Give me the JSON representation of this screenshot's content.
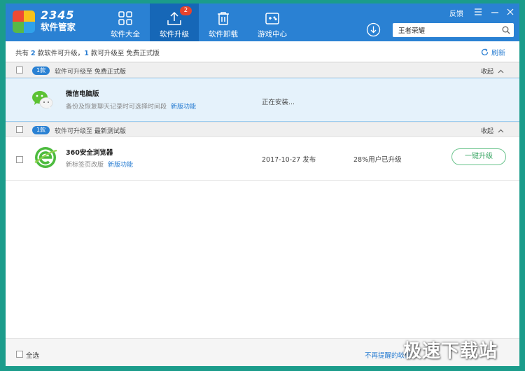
{
  "colors": {
    "header_bg": "#2a81d3",
    "active_tab_bg": "#1667b7",
    "accent": "#2a7ed2",
    "upgrade_green": "#3aa664",
    "badge_red": "#e8432d",
    "border_teal": "#1b9c8b"
  },
  "brand": {
    "number": "2345",
    "name": "软件管家"
  },
  "nav": [
    {
      "label": "软件大全",
      "icon": "grid-icon"
    },
    {
      "label": "软件升级",
      "icon": "upload-icon",
      "badge": "2",
      "active": true
    },
    {
      "label": "软件卸载",
      "icon": "trash-icon"
    },
    {
      "label": "游戏中心",
      "icon": "gamepad-icon"
    }
  ],
  "header": {
    "feedback": "反馈",
    "search_value": "王者荣耀"
  },
  "info": {
    "p1": "共有 ",
    "n1": "2",
    "p2": " 款软件可升级，",
    "n2": "1",
    "p3": " 款可升级至 免费正式版",
    "refresh": "刷新"
  },
  "sections": [
    {
      "badge": "1款",
      "text": "软件可升级至",
      "target": "免费正式版",
      "collapse": "收起"
    },
    {
      "badge": "1款",
      "text": "软件可升级至",
      "target": "最新测试版",
      "collapse": "收起"
    }
  ],
  "apps": [
    {
      "name": "微信电脑版",
      "desc": "备份及恢复聊天记录时可选择时间段",
      "new_feature": "新版功能",
      "status": "正在安装...",
      "icon": "wechat-icon"
    },
    {
      "name": "360安全浏览器",
      "desc": "新标签页改版",
      "new_feature": "新版功能",
      "date": "2017-10-27 发布",
      "users": "28%用户已升级",
      "action": "一键升级",
      "icon": "browser-360-icon"
    }
  ],
  "footer": {
    "select_all": "全选",
    "ignore_link": "不再提醒的软件",
    "watermark": "极速下载站"
  }
}
